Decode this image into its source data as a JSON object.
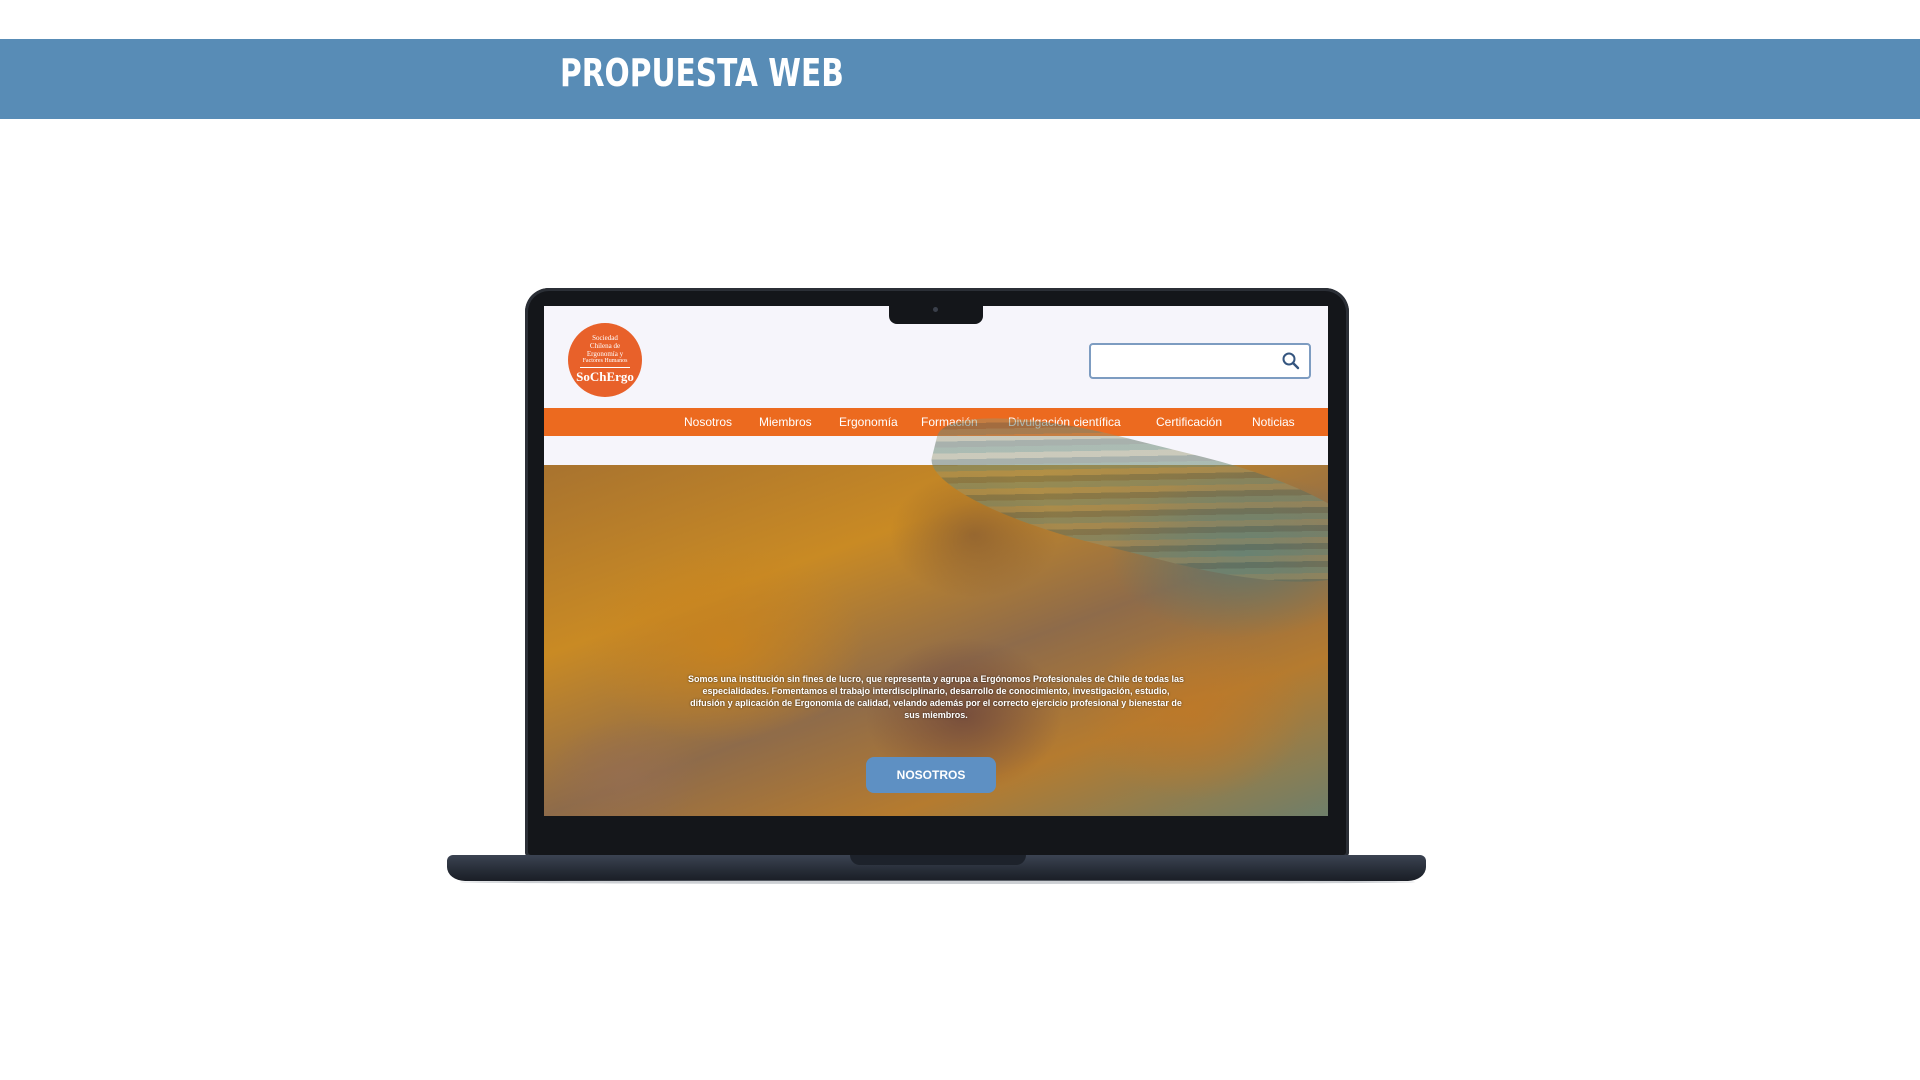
{
  "banner": {
    "title": "PROPUESTA WEB"
  },
  "site": {
    "logo": {
      "line1": "Sociedad",
      "line2": "Chilena de",
      "line3": "Ergonomía y",
      "line4": "Factores Humanos",
      "acronym": "SoChErgo"
    },
    "search": {
      "placeholder": ""
    },
    "nav": [
      "Nosotros",
      "Miembros",
      "Ergonomía",
      "Formación",
      "Divulgación científica",
      "Certificación",
      "Noticias"
    ],
    "hero": {
      "text": "Somos una institución sin fines de lucro, que representa y agrupa a Ergónomos Profesionales de Chile de todas las especialidades. Fomentamos el trabajo interdisciplinario, desarrollo de conocimiento, investigación, estudio, difusión y aplicación de Ergonomía de calidad, velando además por el correcto ejercicio profesional y bienestar de sus miembros.",
      "button": "NOSOTROS"
    }
  },
  "colors": {
    "banner": "#588cb6",
    "accent_orange": "#ec6a1f",
    "button_blue": "#5e90c3"
  }
}
